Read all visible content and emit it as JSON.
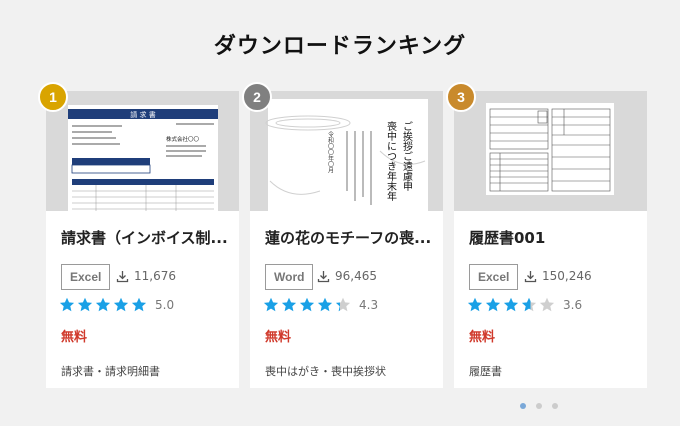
{
  "section_title": "ダウンロードランキング",
  "colors": {
    "price": "#d0392b",
    "star": "#1aa0e6",
    "star_empty": "#cfcfcf"
  },
  "cards": [
    {
      "rank": "1",
      "badge_color": "#d9a400",
      "name": "請求書（インボイス制...",
      "format": "Excel",
      "downloads": "11,676",
      "rating": 5.0,
      "rating_label": "5.0",
      "price": "無料",
      "categories": "請求書・請求明細書",
      "thumb": {
        "heading": "請 求 書",
        "company": "株式会社〇〇"
      }
    },
    {
      "rank": "2",
      "badge_color": "#808080",
      "name": "蓮の花のモチーフの喪...",
      "format": "Word",
      "downloads": "96,465",
      "rating": 4.3,
      "rating_label": "4.3",
      "price": "無料",
      "categories": "喪中はがき・喪中挨拶状",
      "thumb": {
        "line1": "喪中につき年末年",
        "line2": "ご挨拶ご遠慮申",
        "date": "令和〇〇年〇月"
      }
    },
    {
      "rank": "3",
      "badge_color": "#c98a2c",
      "name": "履歴書001",
      "format": "Excel",
      "downloads": "150,246",
      "rating": 3.6,
      "rating_label": "3.6",
      "price": "無料",
      "categories": "履歴書",
      "thumb": {}
    }
  ],
  "carousel": {
    "count": 3,
    "active": 0
  }
}
